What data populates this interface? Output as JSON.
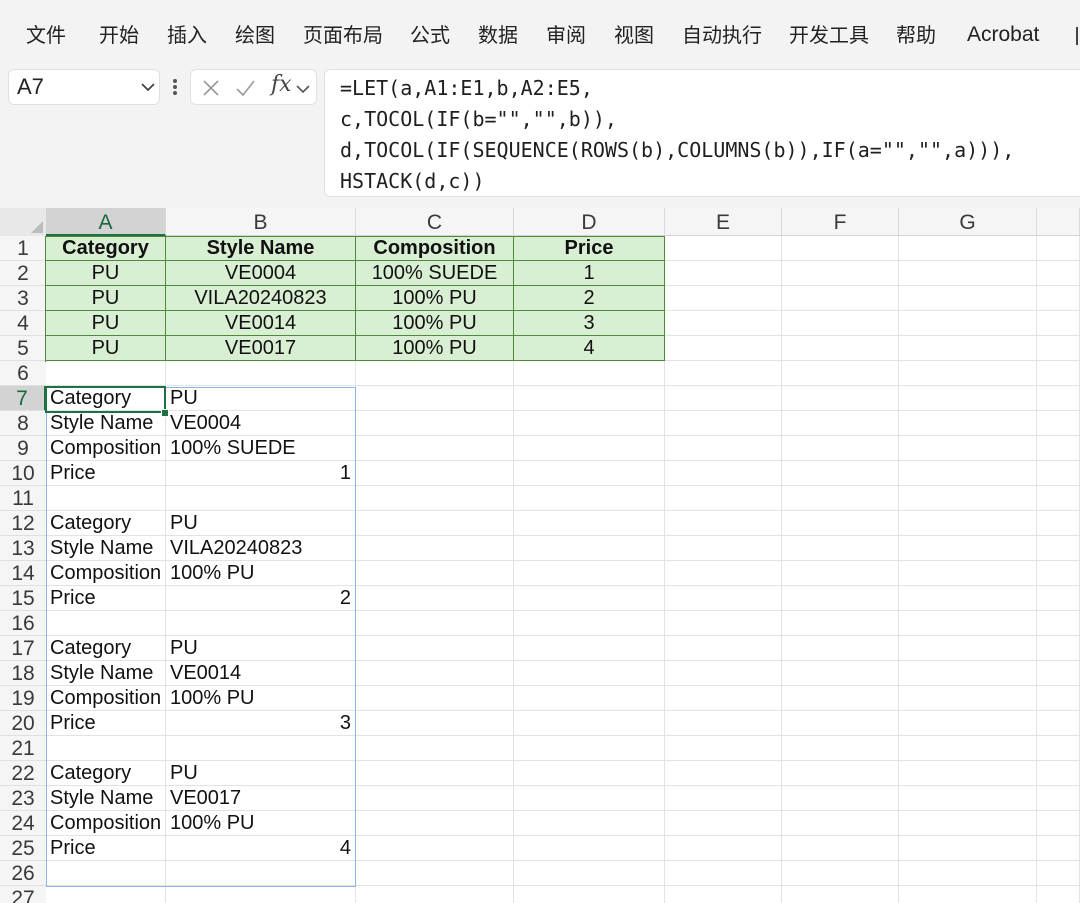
{
  "ribbon": {
    "tabs": [
      "文件",
      "开始",
      "插入",
      "绘图",
      "页面布局",
      "公式",
      "数据",
      "审阅",
      "视图",
      "自动执行",
      "开发工具",
      "帮助",
      "Acrobat"
    ]
  },
  "formula_bar": {
    "name_box": "A7",
    "fx_symbol": "fx",
    "formula_lines": [
      "=LET(a,A1:E1,b,A2:E5,",
      "c,TOCOL(IF(b=\"\",\"\",b)),",
      "d,TOCOL(IF(SEQUENCE(ROWS(b),COLUMNS(b)),IF(a=\"\",\"\",a))),",
      "HSTACK(d,c))"
    ]
  },
  "sheet": {
    "columns": [
      "A",
      "B",
      "C",
      "D",
      "E",
      "F",
      "G"
    ],
    "selected_column": "A",
    "selected_row": 7,
    "source_table": {
      "headers": [
        "Category",
        "Style Name",
        "Composition",
        "Price"
      ],
      "rows": [
        [
          "PU",
          "VE0004",
          "100% SUEDE",
          "1"
        ],
        [
          "PU",
          "VILA20240823",
          "100% PU",
          "2"
        ],
        [
          "PU",
          "VE0014",
          "100% PU",
          "3"
        ],
        [
          "PU",
          "VE0017",
          "100% PU",
          "4"
        ]
      ]
    },
    "output": [
      {
        "row": 7,
        "label": "Category",
        "value": "PU"
      },
      {
        "row": 8,
        "label": "Style Name",
        "value": "VE0004"
      },
      {
        "row": 9,
        "label": "Composition",
        "value": "100% SUEDE"
      },
      {
        "row": 10,
        "label": "Price",
        "value": "1",
        "numeric": true
      },
      {
        "row": 12,
        "label": "Category",
        "value": "PU"
      },
      {
        "row": 13,
        "label": "Style Name",
        "value": "VILA20240823"
      },
      {
        "row": 14,
        "label": "Composition",
        "value": "100% PU"
      },
      {
        "row": 15,
        "label": "Price",
        "value": "2",
        "numeric": true
      },
      {
        "row": 17,
        "label": "Category",
        "value": "PU"
      },
      {
        "row": 18,
        "label": "Style Name",
        "value": "VE0014"
      },
      {
        "row": 19,
        "label": "Composition",
        "value": "100% PU"
      },
      {
        "row": 20,
        "label": "Price",
        "value": "3",
        "numeric": true
      },
      {
        "row": 22,
        "label": "Category",
        "value": "PU"
      },
      {
        "row": 23,
        "label": "Style Name",
        "value": "VE0017"
      },
      {
        "row": 24,
        "label": "Composition",
        "value": "100% PU"
      },
      {
        "row": 25,
        "label": "Price",
        "value": "4",
        "numeric": true
      }
    ],
    "visible_rows": 27
  },
  "colors": {
    "table_fill": "#d9efd3",
    "table_border": "#4e8a3c",
    "selection": "#1e7145",
    "spill_border": "#8db3e2"
  }
}
